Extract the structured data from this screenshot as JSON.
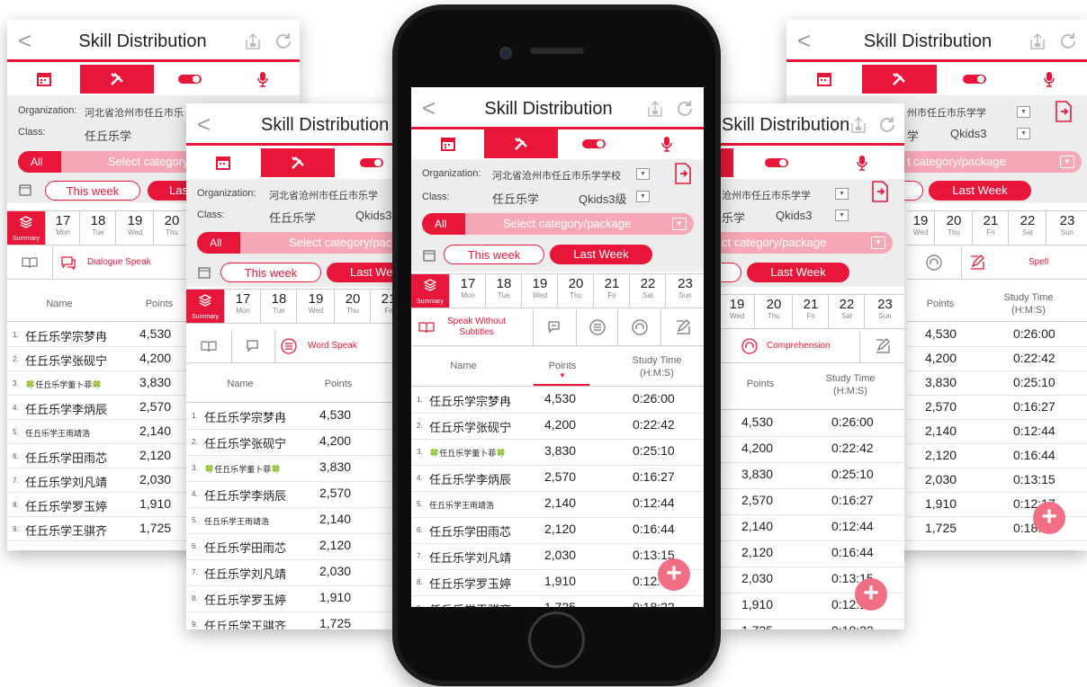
{
  "app": {
    "title": "Skill Distribution",
    "org_label": "Organization:",
    "org_value": "河北省沧州市任丘市乐学学校",
    "org_value_short": "河北省沧州市任丘市乐学",
    "org_value_cut": "河北省沧州市任丘市乐",
    "org_value_right": "沧州市任丘市乐学学",
    "org_value_far": "州市任丘市乐学学",
    "class_label": "Class:",
    "class_value": "任丘乐学",
    "class_value_right": "乐学",
    "class_value_far": "学",
    "class_suffix": "Qkids3级",
    "class_suffix_short": "Qkids3",
    "class_suffix_cut": "Qki",
    "category_all": "All",
    "category_placeholder": "Select category/package",
    "category_placeholder_cut": "Select category/p",
    "category_placeholder_cut2": "Select category/pack",
    "category_placeholder_right": "t category/package",
    "category_placeholder_right2": "ct category/package",
    "this_week": "This week",
    "last_week": "Last Week",
    "last_week_cut": "Las",
    "last_week_cut2": "Last We"
  },
  "days": [
    {
      "num": "17",
      "wd": "Mon"
    },
    {
      "num": "18",
      "wd": "Tue"
    },
    {
      "num": "19",
      "wd": "Wed"
    },
    {
      "num": "20",
      "wd": "Thu"
    },
    {
      "num": "21",
      "wd": "Fri"
    },
    {
      "num": "22",
      "wd": "Sat"
    },
    {
      "num": "23",
      "wd": "Sun"
    }
  ],
  "summary_label": "Summary",
  "skills": {
    "dialogue": "Dialogue Speak",
    "word": "Word Speak",
    "speak_line1": "Speak Without",
    "speak_line2": "Subtitles",
    "comprehension": "Comprehension",
    "spell": "Spell"
  },
  "columns": {
    "name": "Name",
    "points": "Points",
    "study_time": "Study Time",
    "study_time_unit": "(H:M:S)"
  },
  "rows": [
    {
      "rank": "1.",
      "name": "任丘乐学宗梦冉",
      "points": "4,530",
      "time": "0:26:00"
    },
    {
      "rank": "2.",
      "name": "任丘乐学张砚宁",
      "points": "4,200",
      "time": "0:22:42"
    },
    {
      "rank": "3.",
      "name": "🍀任丘乐学董卜菲🍀",
      "points": "3,830",
      "time": "0:25:10"
    },
    {
      "rank": "4.",
      "name": "任丘乐学李炳辰",
      "points": "2,570",
      "time": "0:16:27"
    },
    {
      "rank": "5.",
      "name": "任丘乐学王雨靖浩",
      "points": "2,140",
      "time": "0:12:44"
    },
    {
      "rank": "6.",
      "name": "任丘乐学田雨芯",
      "points": "2,120",
      "time": "0:16:44"
    },
    {
      "rank": "7.",
      "name": "任丘乐学刘凡靖",
      "points": "2,030",
      "time": "0:13:15"
    },
    {
      "rank": "8.",
      "name": "任丘乐学罗玉婷",
      "points": "1,910",
      "time": "0:12:17"
    },
    {
      "rank": "9.",
      "name": "任丘乐学王骐齐",
      "points": "1,725",
      "time": "0:18:22"
    }
  ],
  "fab_label": "+",
  "colors": {
    "accent": "#e8173a",
    "accent_light": "#f7a8b6",
    "fab": "#f16f85"
  }
}
